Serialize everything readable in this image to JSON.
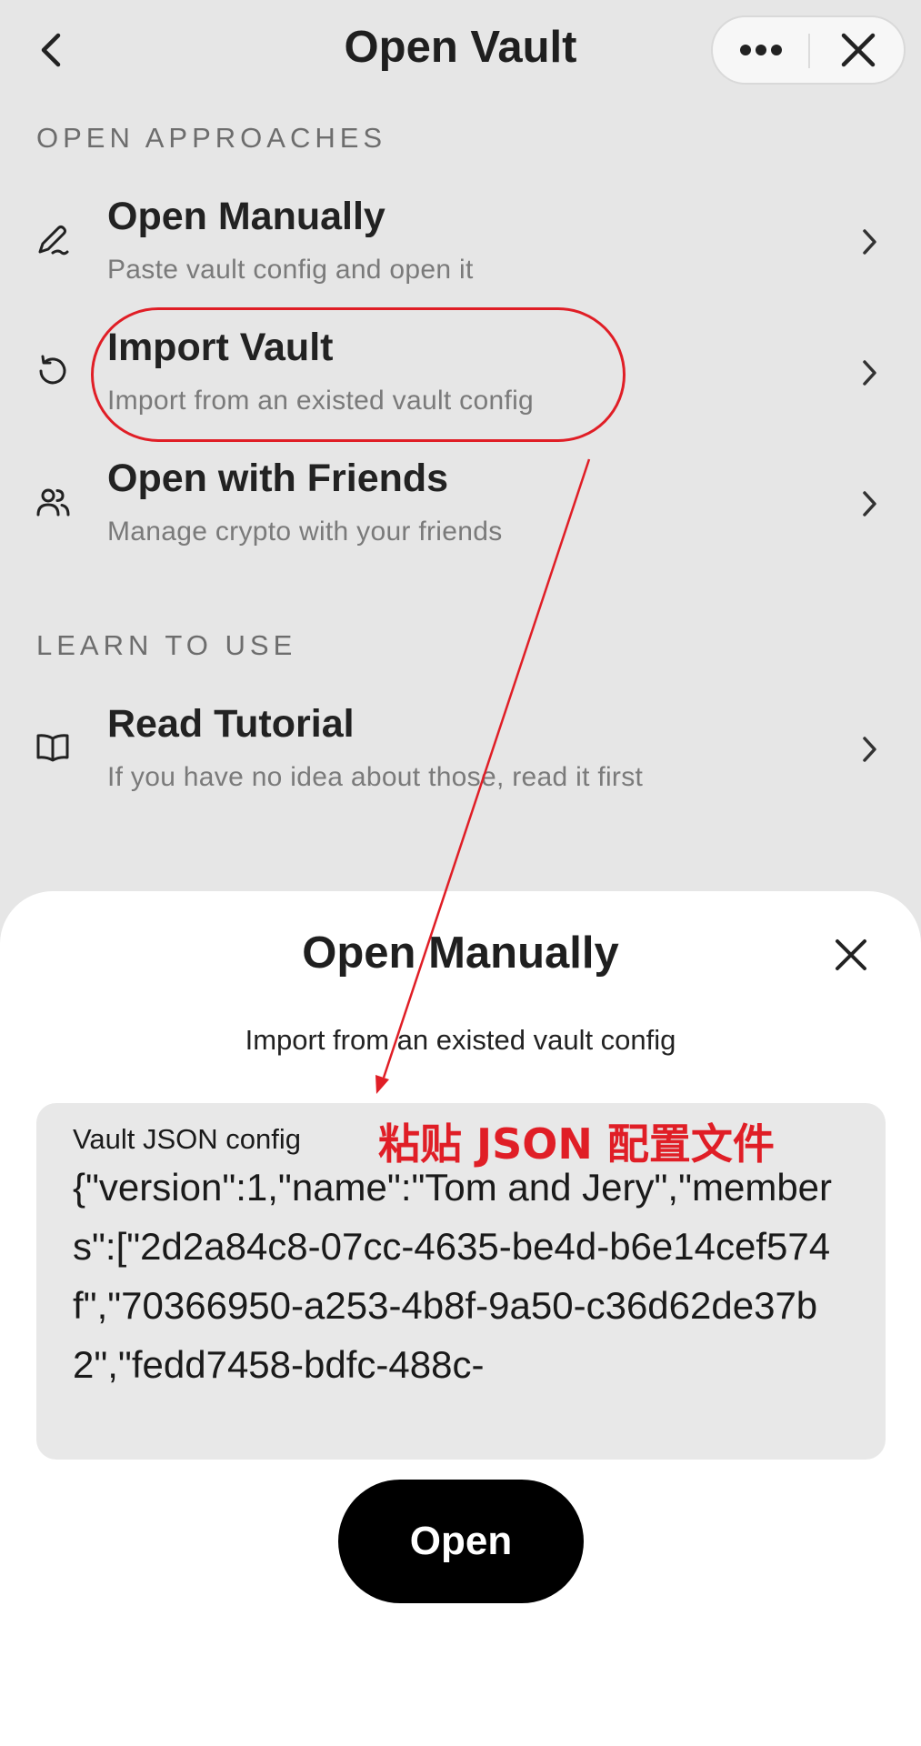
{
  "header": {
    "title": "Open Vault",
    "back_icon": "chevron-left-icon",
    "more_icon": "more-dots-icon",
    "close_icon": "close-icon"
  },
  "sections": [
    {
      "label": "OPEN APPROACHES",
      "items": [
        {
          "icon": "pen-icon",
          "title": "Open Manually",
          "subtitle": "Paste vault config and open it"
        },
        {
          "icon": "history-icon",
          "title": "Import Vault",
          "subtitle": "Import from an existed vault config"
        },
        {
          "icon": "users-icon",
          "title": "Open with Friends",
          "subtitle": "Manage crypto with your friends"
        }
      ]
    },
    {
      "label": "LEARN TO USE",
      "items": [
        {
          "icon": "book-icon",
          "title": "Read Tutorial",
          "subtitle": "If you have no idea about those, read it first"
        }
      ]
    }
  ],
  "sheet": {
    "title": "Open Manually",
    "subtitle": "Import from an existed vault config",
    "field_label": "Vault JSON config",
    "field_value": "{\"version\":1,\"name\":\"Tom and Jery\",\"members\":[\"2d2a84c8-07cc-4635-be4d-b6e14cef574f\",\"70366950-a253-4b8f-9a50-c36d62de37b2\",\"fedd7458-bdfc-488c-",
    "open_label": "Open"
  },
  "annotation": {
    "text": "粘贴 JSON 配置文件",
    "color": "#e01e26"
  }
}
